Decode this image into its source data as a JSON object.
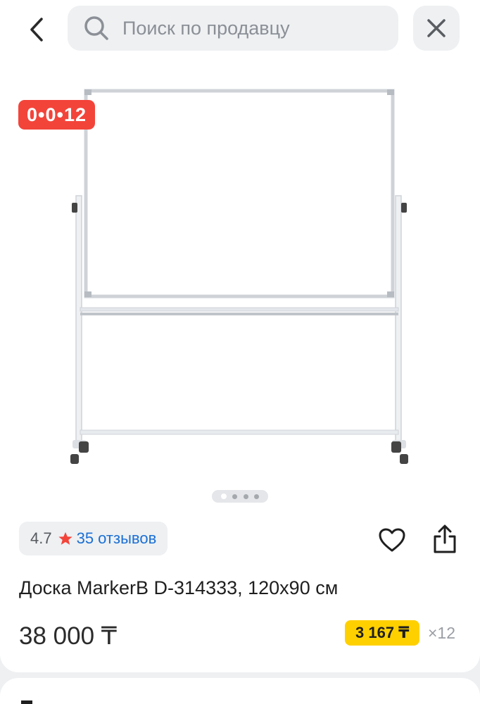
{
  "header": {
    "search_placeholder": "Поиск по продавцу"
  },
  "product": {
    "promo_badge": "0•0•12",
    "gallery": {
      "total": 4,
      "active": 1
    },
    "rating": "4.7",
    "reviews_label": "35 отзывов",
    "title": "Доска MarkerB D-314333, 120x90 см",
    "price": "38 000 ₸",
    "installment_price": "3 167 ₸",
    "installment_count": "×12"
  },
  "colors": {
    "badge": "#f3443a",
    "link": "#1a6fd4",
    "installment_bg": "#ffd000",
    "star": "#f3443a"
  },
  "icons": {
    "back": "chevron-left-icon",
    "search": "search-icon",
    "close": "close-icon",
    "star": "star-icon",
    "favorite": "heart-icon",
    "share": "share-icon"
  }
}
